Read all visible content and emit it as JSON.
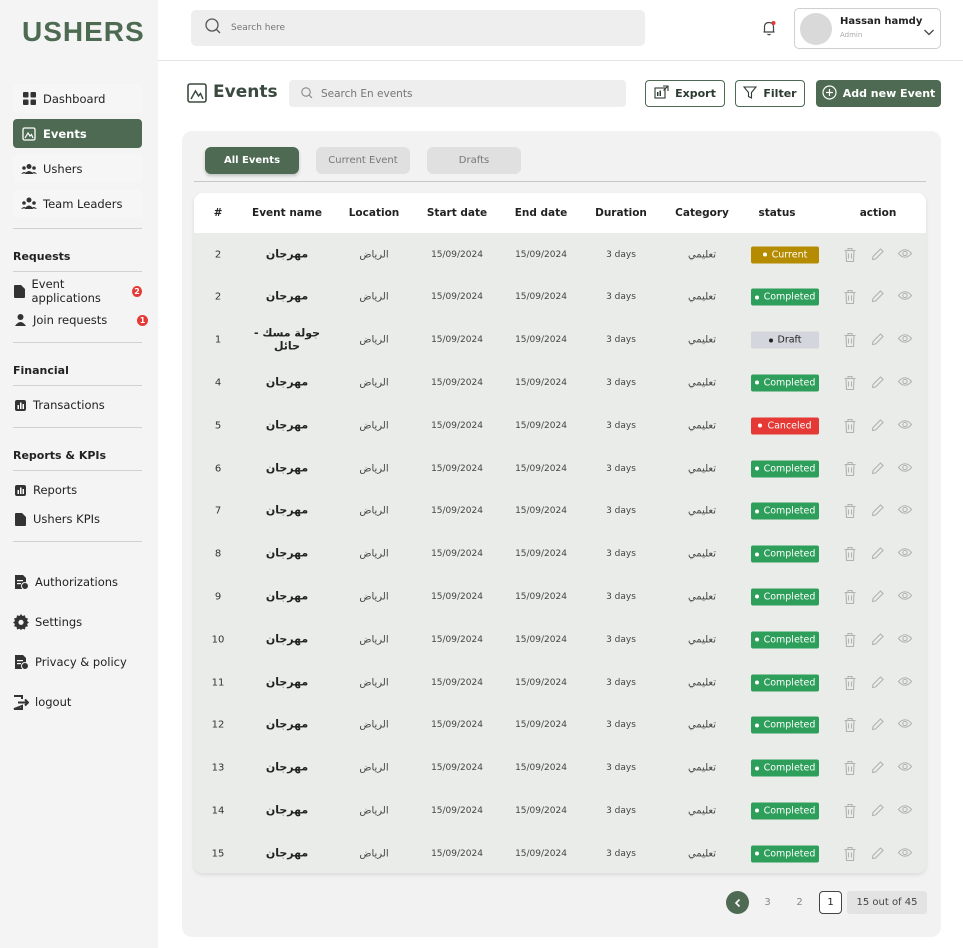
{
  "app": {
    "logo": "USHERS"
  },
  "topbar": {
    "search_placeholder": "Search here",
    "user_name": "Hassan hamdy",
    "user_role": "Admin"
  },
  "sidebar": {
    "main_items": [
      {
        "label": "Dashboard",
        "icon": "grid-icon"
      },
      {
        "label": "Events",
        "icon": "image-icon"
      },
      {
        "label": "Ushers",
        "icon": "users-icon"
      },
      {
        "label": "Team Leaders",
        "icon": "team-icon"
      }
    ],
    "sections": {
      "requests_title": "Requests",
      "event_applications": "Event applications",
      "event_applications_count": "2",
      "join_requests": "Join requests",
      "join_requests_count": "1",
      "financial_title": "Financial",
      "transactions": "Transactions",
      "reports_title": "Reports & KPIs",
      "reports": "Reports",
      "ushers_kpis": "Ushers KPIs"
    },
    "bottom_items": {
      "authorizations": "Authorizations",
      "settings": "Settings",
      "privacy": "Privacy & policy",
      "logout": "logout"
    }
  },
  "page": {
    "title": "Events",
    "search_placeholder": "Search En events",
    "export_label": "Export",
    "filter_label": "Filter",
    "add_label": "Add new Event"
  },
  "tabs": [
    "All Events",
    "Current Event",
    "Drafts"
  ],
  "table": {
    "headers": [
      "#",
      "Event name",
      "Location",
      "Start date",
      "End date",
      "Duration",
      "Category",
      "status",
      "action"
    ],
    "rows": [
      {
        "num": "2",
        "name": "مهرجان",
        "location": "الرياض",
        "start": "15/09/2024",
        "end": "15/09/2024",
        "duration": "3 days",
        "category": "تعليمي",
        "status": "Current"
      },
      {
        "num": "2",
        "name": "مهرجان",
        "location": "الرياض",
        "start": "15/09/2024",
        "end": "15/09/2024",
        "duration": "3 days",
        "category": "تعليمي",
        "status": "Completed"
      },
      {
        "num": "1",
        "name": "جولة مسك - حائل",
        "location": "الرياض",
        "start": "15/09/2024",
        "end": "15/09/2024",
        "duration": "3 days",
        "category": "تعليمي",
        "status": "Draft"
      },
      {
        "num": "4",
        "name": "مهرجان",
        "location": "الرياض",
        "start": "15/09/2024",
        "end": "15/09/2024",
        "duration": "3 days",
        "category": "تعليمي",
        "status": "Completed"
      },
      {
        "num": "5",
        "name": "مهرجان",
        "location": "الرياض",
        "start": "15/09/2024",
        "end": "15/09/2024",
        "duration": "3 days",
        "category": "تعليمي",
        "status": "Canceled"
      },
      {
        "num": "6",
        "name": "مهرجان",
        "location": "الرياض",
        "start": "15/09/2024",
        "end": "15/09/2024",
        "duration": "3 days",
        "category": "تعليمي",
        "status": "Completed"
      },
      {
        "num": "7",
        "name": "مهرجان",
        "location": "الرياض",
        "start": "15/09/2024",
        "end": "15/09/2024",
        "duration": "3 days",
        "category": "تعليمي",
        "status": "Completed"
      },
      {
        "num": "8",
        "name": "مهرجان",
        "location": "الرياض",
        "start": "15/09/2024",
        "end": "15/09/2024",
        "duration": "3 days",
        "category": "تعليمي",
        "status": "Completed"
      },
      {
        "num": "9",
        "name": "مهرجان",
        "location": "الرياض",
        "start": "15/09/2024",
        "end": "15/09/2024",
        "duration": "3 days",
        "category": "تعليمي",
        "status": "Completed"
      },
      {
        "num": "10",
        "name": "مهرجان",
        "location": "الرياض",
        "start": "15/09/2024",
        "end": "15/09/2024",
        "duration": "3 days",
        "category": "تعليمي",
        "status": "Completed"
      },
      {
        "num": "11",
        "name": "مهرجان",
        "location": "الرياض",
        "start": "15/09/2024",
        "end": "15/09/2024",
        "duration": "3 days",
        "category": "تعليمي",
        "status": "Completed"
      },
      {
        "num": "12",
        "name": "مهرجان",
        "location": "الرياض",
        "start": "15/09/2024",
        "end": "15/09/2024",
        "duration": "3 days",
        "category": "تعليمي",
        "status": "Completed"
      },
      {
        "num": "13",
        "name": "مهرجان",
        "location": "الرياض",
        "start": "15/09/2024",
        "end": "15/09/2024",
        "duration": "3 days",
        "category": "تعليمي",
        "status": "Completed"
      },
      {
        "num": "14",
        "name": "مهرجان",
        "location": "الرياض",
        "start": "15/09/2024",
        "end": "15/09/2024",
        "duration": "3 days",
        "category": "تعليمي",
        "status": "Completed"
      },
      {
        "num": "15",
        "name": "مهرجان",
        "location": "الرياض",
        "start": "15/09/2024",
        "end": "15/09/2024",
        "duration": "3 days",
        "category": "تعليمي",
        "status": "Completed"
      }
    ]
  },
  "status_colors": {
    "Current": "#b58b00",
    "Completed": "#2e9e5b",
    "Draft": "#d3d6dd",
    "Canceled": "#e53935"
  },
  "pagination": {
    "pages": [
      "3",
      "2",
      "1"
    ],
    "current": "1",
    "info": "15 out of 45"
  },
  "colors": {
    "brand": "#4e6a52"
  }
}
